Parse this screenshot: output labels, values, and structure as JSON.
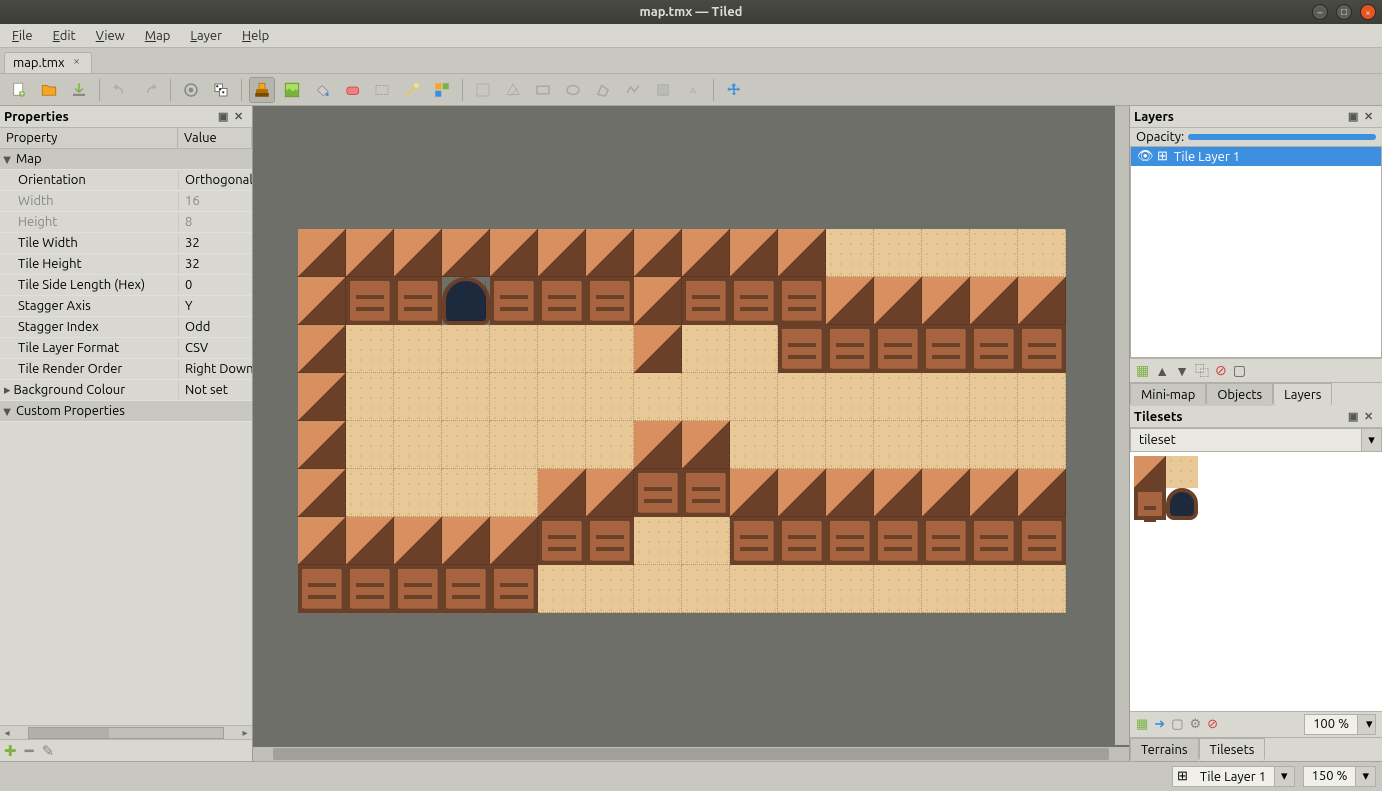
{
  "window": {
    "title": "map.tmx — Tiled"
  },
  "menu": {
    "file": "File",
    "edit": "Edit",
    "view": "View",
    "map": "Map",
    "layer": "Layer",
    "help": "Help"
  },
  "tab": {
    "name": "map.tmx"
  },
  "properties": {
    "title": "Properties",
    "col_prop": "Property",
    "col_val": "Value",
    "group_map": "Map",
    "rows": {
      "orientation": {
        "n": "Orientation",
        "v": "Orthogonal"
      },
      "width": {
        "n": "Width",
        "v": "16"
      },
      "height": {
        "n": "Height",
        "v": "8"
      },
      "tile_width": {
        "n": "Tile Width",
        "v": "32"
      },
      "tile_height": {
        "n": "Tile Height",
        "v": "32"
      },
      "tile_side": {
        "n": "Tile Side Length (Hex)",
        "v": "0"
      },
      "stagger_axis": {
        "n": "Stagger Axis",
        "v": "Y"
      },
      "stagger_index": {
        "n": "Stagger Index",
        "v": "Odd"
      },
      "layer_format": {
        "n": "Tile Layer Format",
        "v": "CSV"
      },
      "render_order": {
        "n": "Tile Render Order",
        "v": "Right Down"
      },
      "bg_colour": {
        "n": "Background Colour",
        "v": "Not set"
      }
    },
    "group_custom": "Custom Properties"
  },
  "layers_panel": {
    "title": "Layers",
    "opacity_label": "Opacity:",
    "items": [
      {
        "name": "Tile Layer 1"
      }
    ],
    "tabs": {
      "minimap": "Mini-map",
      "objects": "Objects",
      "layers": "Layers"
    }
  },
  "tilesets_panel": {
    "title": "Tilesets",
    "selected": "tileset",
    "tabs": {
      "terrains": "Terrains",
      "tilesets": "Tilesets"
    },
    "zoom": "100 %"
  },
  "status": {
    "layer": "Tile Layer 1",
    "zoom": "150 %"
  },
  "map": {
    "cols": 16,
    "rows": 8,
    "grid": [
      [
        1,
        1,
        1,
        1,
        1,
        1,
        1,
        1,
        1,
        1,
        1,
        2,
        2,
        2,
        2,
        2
      ],
      [
        1,
        3,
        3,
        4,
        3,
        3,
        3,
        1,
        3,
        3,
        3,
        1,
        1,
        1,
        1,
        1
      ],
      [
        1,
        2,
        2,
        2,
        2,
        2,
        2,
        1,
        2,
        2,
        3,
        3,
        3,
        3,
        3,
        3
      ],
      [
        1,
        2,
        2,
        2,
        2,
        2,
        2,
        2,
        2,
        2,
        2,
        2,
        2,
        2,
        2,
        2
      ],
      [
        1,
        2,
        2,
        2,
        2,
        2,
        2,
        1,
        1,
        2,
        2,
        2,
        2,
        2,
        2,
        2
      ],
      [
        1,
        2,
        2,
        2,
        2,
        1,
        1,
        3,
        3,
        1,
        1,
        1,
        1,
        1,
        1,
        1
      ],
      [
        1,
        1,
        1,
        1,
        1,
        3,
        3,
        2,
        2,
        3,
        3,
        3,
        3,
        3,
        3,
        3
      ],
      [
        3,
        3,
        3,
        3,
        3,
        2,
        2,
        2,
        2,
        2,
        2,
        2,
        2,
        2,
        2,
        2
      ]
    ]
  }
}
